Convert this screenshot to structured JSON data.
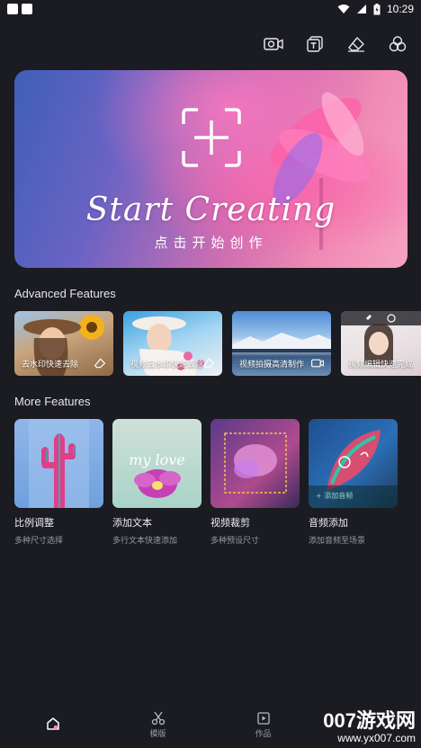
{
  "status_bar": {
    "time": "10:29"
  },
  "toolbar": {
    "icons": [
      "video-camera-icon",
      "text-frame-icon",
      "eraser-icon",
      "three-circles-icon"
    ]
  },
  "hero": {
    "title": "Start Creating",
    "subtitle": "点击开始创作"
  },
  "advanced": {
    "title": "Advanced Features",
    "items": [
      {
        "label": "去水印快速去除",
        "icon": "eraser-icon"
      },
      {
        "label": "视频去水印快速去除",
        "icon": "eraser-icon"
      },
      {
        "label": "视频拍摄高清制作",
        "icon": "camera-icon"
      },
      {
        "label": "视频编辑快速完成",
        "icon": "eraser-icon"
      }
    ]
  },
  "more": {
    "title": "More Features",
    "items": [
      {
        "name": "比例调整",
        "desc": "多种尺寸选择"
      },
      {
        "name": "添加文本",
        "desc": "多行文本快速添加"
      },
      {
        "name": "视频裁剪",
        "desc": "多种预设尺寸"
      },
      {
        "name": "音频添加",
        "desc": "添加音频至场景"
      }
    ],
    "card2_script": "my love",
    "card4_overlay": "+ 添加音频"
  },
  "bottom_nav": {
    "items": [
      {
        "label": "",
        "icon": "home-icon"
      },
      {
        "label": "模版",
        "icon": "scissors-icon"
      },
      {
        "label": "作品",
        "icon": "play-box-icon"
      }
    ]
  },
  "watermark": {
    "main": "007游戏网",
    "sub": "www.yx007.com"
  },
  "colors": {
    "background": "#1b1b22",
    "accent": "#f38ab7"
  }
}
